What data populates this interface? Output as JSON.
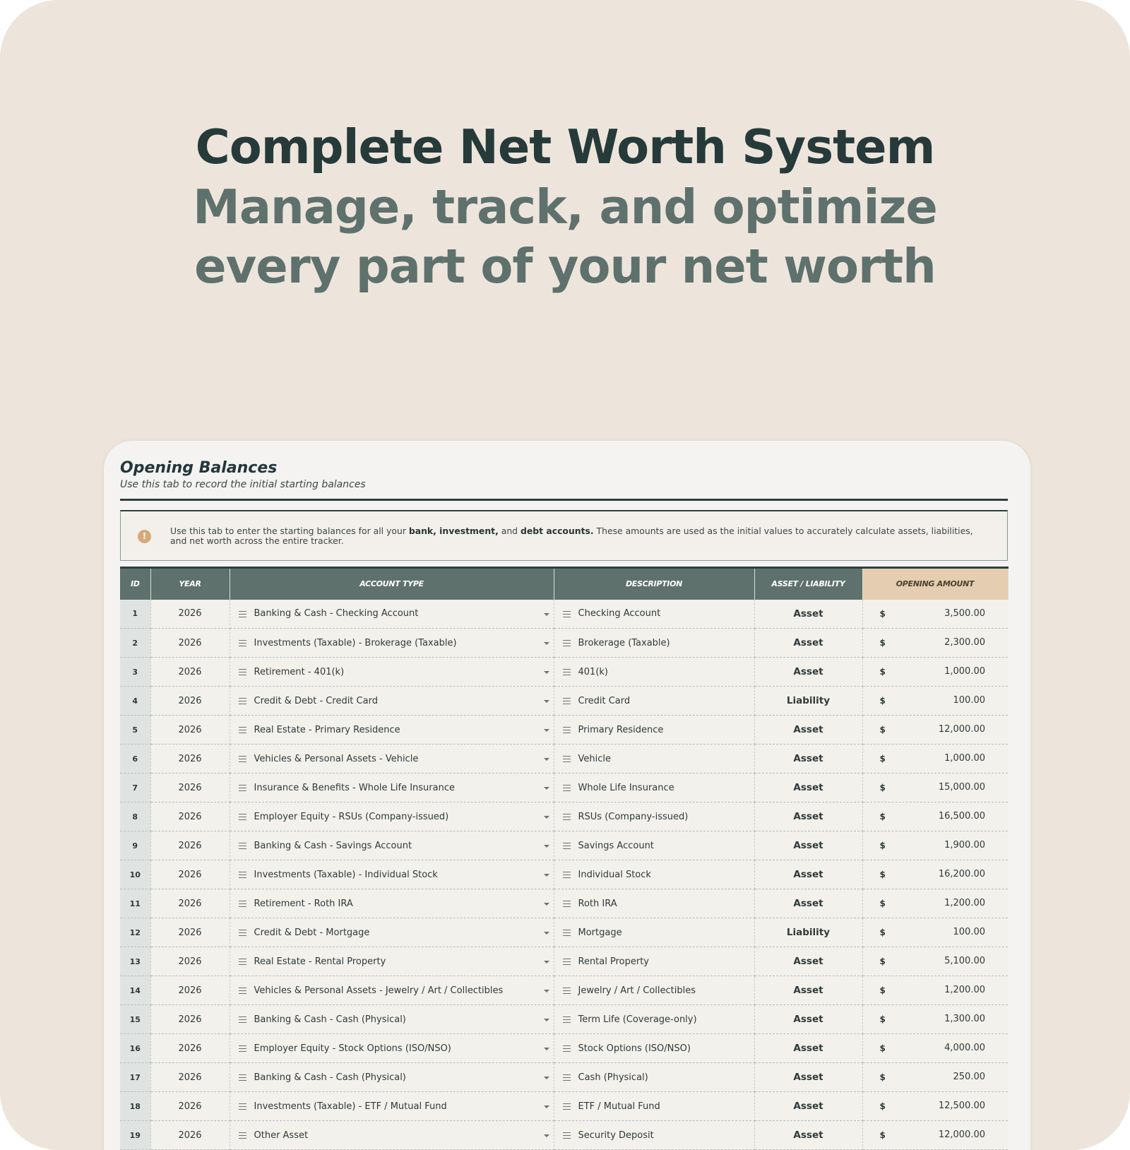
{
  "hero": {
    "title": "Complete Net Worth System",
    "subtitle": "Manage, track, and optimize every part of your net worth"
  },
  "sheet": {
    "title": "Opening Balances",
    "subtitle": "Use this tab to record the initial starting balances",
    "info": {
      "icon": "info-icon",
      "text_1": "Use this tab to enter the starting balances for all your ",
      "bold_1": "bank, investment,",
      "text_2": " and ",
      "bold_2": "debt accounts.",
      "text_3": " These amounts are used as the initial values to accurately calculate assets, liabilities, and net worth across the entire tracker."
    },
    "columns": {
      "id": "ID",
      "year": "YEAR",
      "account_type": "ACCOUNT TYPE",
      "description": "DESCRIPTION",
      "asset_liability": "ASSET / LIABILITY",
      "opening_amount": "OPENING AMOUNT"
    },
    "currency_symbol": "$",
    "rows": [
      {
        "id": "1",
        "year": "2026",
        "type": "Banking & Cash - Checking Account",
        "desc": "Checking Account",
        "al": "Asset",
        "amount": "3,500.00"
      },
      {
        "id": "2",
        "year": "2026",
        "type": "Investments (Taxable) - Brokerage (Taxable)",
        "desc": "Brokerage (Taxable)",
        "al": "Asset",
        "amount": "2,300.00"
      },
      {
        "id": "3",
        "year": "2026",
        "type": "Retirement - 401(k)",
        "desc": "401(k)",
        "al": "Asset",
        "amount": "1,000.00"
      },
      {
        "id": "4",
        "year": "2026",
        "type": "Credit & Debt - Credit Card",
        "desc": "Credit Card",
        "al": "Liability",
        "amount": "100.00"
      },
      {
        "id": "5",
        "year": "2026",
        "type": "Real Estate - Primary Residence",
        "desc": "Primary Residence",
        "al": "Asset",
        "amount": "12,000.00"
      },
      {
        "id": "6",
        "year": "2026",
        "type": "Vehicles & Personal Assets - Vehicle",
        "desc": "Vehicle",
        "al": "Asset",
        "amount": "1,000.00"
      },
      {
        "id": "7",
        "year": "2026",
        "type": "Insurance & Benefits - Whole Life Insurance",
        "desc": "Whole Life Insurance",
        "al": "Asset",
        "amount": "15,000.00"
      },
      {
        "id": "8",
        "year": "2026",
        "type": "Employer Equity - RSUs (Company-issued)",
        "desc": "RSUs (Company-issued)",
        "al": "Asset",
        "amount": "16,500.00"
      },
      {
        "id": "9",
        "year": "2026",
        "type": "Banking & Cash - Savings Account",
        "desc": "Savings Account",
        "al": "Asset",
        "amount": "1,900.00"
      },
      {
        "id": "10",
        "year": "2026",
        "type": "Investments (Taxable) - Individual Stock",
        "desc": "Individual Stock",
        "al": "Asset",
        "amount": "16,200.00"
      },
      {
        "id": "11",
        "year": "2026",
        "type": "Retirement - Roth IRA",
        "desc": "Roth IRA",
        "al": "Asset",
        "amount": "1,200.00"
      },
      {
        "id": "12",
        "year": "2026",
        "type": "Credit & Debt - Mortgage",
        "desc": "Mortgage",
        "al": "Liability",
        "amount": "100.00"
      },
      {
        "id": "13",
        "year": "2026",
        "type": "Real Estate - Rental Property",
        "desc": "Rental Property",
        "al": "Asset",
        "amount": "5,100.00"
      },
      {
        "id": "14",
        "year": "2026",
        "type": "Vehicles & Personal Assets - Jewelry / Art / Collectibles",
        "desc": "Jewelry / Art / Collectibles",
        "al": "Asset",
        "amount": "1,200.00"
      },
      {
        "id": "15",
        "year": "2026",
        "type": "Banking & Cash - Cash (Physical)",
        "desc": "Term Life (Coverage-only)",
        "al": "Asset",
        "amount": "1,300.00"
      },
      {
        "id": "16",
        "year": "2026",
        "type": "Employer Equity - Stock Options (ISO/NSO)",
        "desc": "Stock Options (ISO/NSO)",
        "al": "Asset",
        "amount": "4,000.00"
      },
      {
        "id": "17",
        "year": "2026",
        "type": "Banking & Cash - Cash (Physical)",
        "desc": "Cash (Physical)",
        "al": "Asset",
        "amount": "250.00"
      },
      {
        "id": "18",
        "year": "2026",
        "type": "Investments (Taxable) - ETF / Mutual Fund",
        "desc": "ETF / Mutual Fund",
        "al": "Asset",
        "amount": "12,500.00"
      },
      {
        "id": "19",
        "year": "2026",
        "type": "Other Asset",
        "desc": "Security Deposit",
        "al": "Asset",
        "amount": "12,000.00"
      }
    ]
  }
}
